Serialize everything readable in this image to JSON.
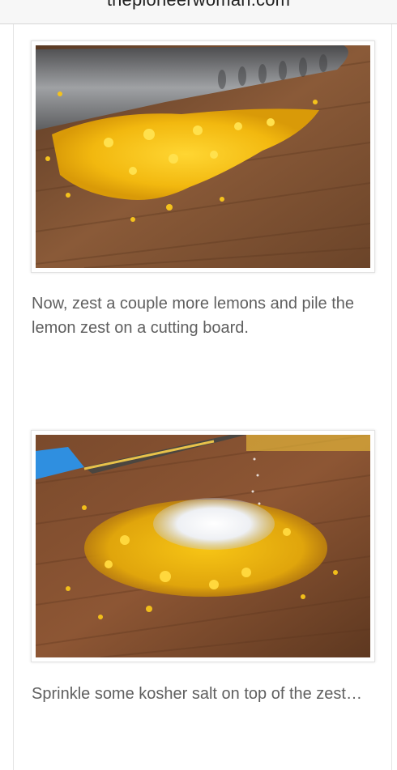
{
  "browser": {
    "url_display": "thepioneerwoman.com"
  },
  "article": {
    "step1": {
      "caption": "Now, zest a couple more lemons and pile the lemon zest on a cutting board."
    },
    "step2": {
      "caption": "Sprinkle some kosher salt on top of the zest…"
    }
  },
  "colors": {
    "zest": "#f2c21b",
    "board": "#7a4a2c",
    "caption_text": "#5f5f5f"
  },
  "icons": {
    "photo1": "knife-lemon-zest-photo",
    "photo2": "salt-lemon-zest-photo"
  }
}
